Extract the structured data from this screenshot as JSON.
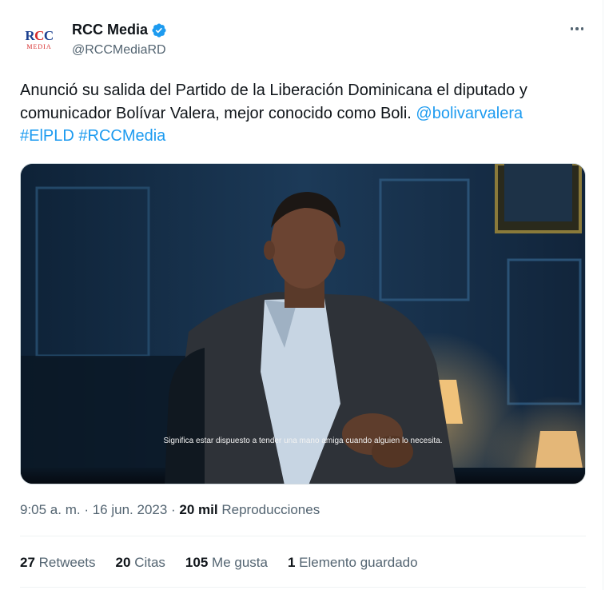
{
  "author": {
    "avatar_text_top": "RCC",
    "avatar_text_bottom": "MEDIA",
    "display_name": "RCC Media",
    "handle": "@RCCMediaRD",
    "verified": true
  },
  "icons": {
    "more": "more-horizontal-icon",
    "verified": "verified-badge-icon"
  },
  "tweet": {
    "text": "Anunció su salida del Partido de la Liberación Dominicana el diputado y comunicador Bolívar Valera, mejor conocido como Boli.",
    "mention": "@bolivarvalera",
    "hashtag1": "#ElPLD",
    "hashtag2": "#RCCMedia"
  },
  "video": {
    "subtitle": "Significa estar dispuesto a tender una mano amiga cuando alguien lo necesita."
  },
  "meta": {
    "time": "9:05 a. m.",
    "sep1": " · ",
    "date": "16 jun. 2023",
    "sep2": " · ",
    "views_count": "20 mil",
    "views_label": "Reproducciones"
  },
  "stats": {
    "retweets_count": "27",
    "retweets_label": "Retweets",
    "quotes_count": "20",
    "quotes_label": "Citas",
    "likes_count": "105",
    "likes_label": "Me gusta",
    "bookmarks_count": "1",
    "bookmarks_label": "Elemento guardado"
  },
  "colors": {
    "accent": "#1d9bf0",
    "text": "#0f1419",
    "muted": "#536471",
    "divider": "#eff3f4"
  }
}
